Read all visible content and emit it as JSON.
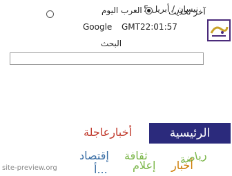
{
  "header": {
    "date_fragment": "5 نيسان / أبريل",
    "last_update": "آخر تحديث",
    "time": "GMT22:01:57",
    "google": "Google"
  },
  "edition": {
    "options": [
      {
        "label": "العرب اليوم",
        "selected": true
      },
      {
        "label": "",
        "selected": false
      }
    ]
  },
  "search": {
    "label": "البحث",
    "value": ""
  },
  "nav": {
    "home": "الرئيسية",
    "breaking": "أخبارعاجلة",
    "sports": "رياضة",
    "culture": "ثقافة",
    "economy": "إقتصاد",
    "news": "أخبار",
    "media": "إعلام",
    "partial_lower": "أ..."
  },
  "watermark": "site-preview.org",
  "colors": {
    "home_bg": "#2b2a7c",
    "breaking": "#c0392b",
    "sports": "#7ab648",
    "culture": "#7ab648",
    "economy": "#3a6ea5",
    "news": "#cc7a00",
    "media": "#7ab648"
  }
}
